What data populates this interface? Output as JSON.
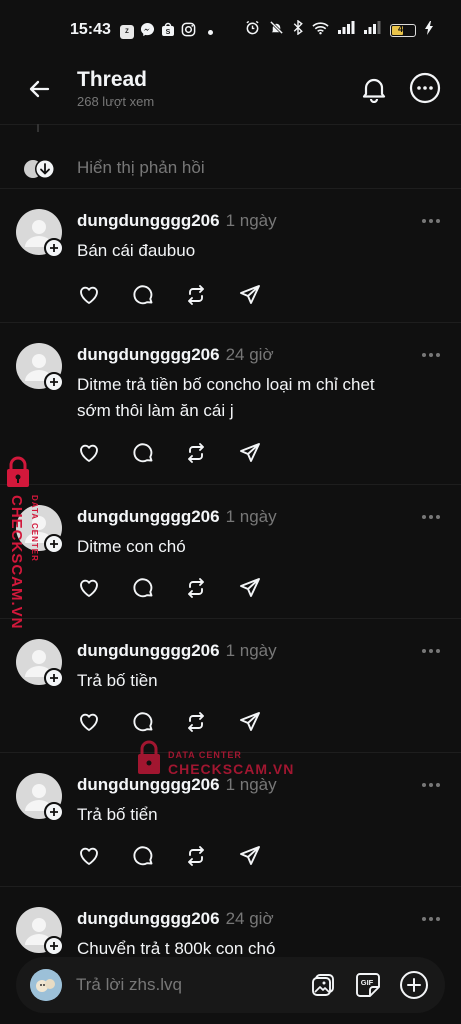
{
  "status_bar": {
    "time": "15:43",
    "battery": "47",
    "left_icons": [
      "zalo-icon",
      "messenger-icon",
      "shopee-icon",
      "instagram-icon"
    ],
    "right_icons": [
      "alarm-icon",
      "mute-icon",
      "bluetooth-icon",
      "wifi-icon",
      "signal-icon",
      "signal-icon",
      "battery-icon",
      "charging-icon"
    ]
  },
  "header": {
    "title": "Thread",
    "subtitle": "268 lượt xem"
  },
  "show_replies": {
    "label": "Hiển thị phản hồi"
  },
  "posts": [
    {
      "username": "dungdungggg206",
      "time": "1 ngày",
      "lines": [
        "Bán cái đaubuo"
      ]
    },
    {
      "username": "dungdungggg206",
      "time": "24 giờ",
      "lines": [
        "Ditme trả tiền bố concho loại m chỉ chet",
        "sớm thôi làm ăn cái j"
      ]
    },
    {
      "username": "dungdungggg206",
      "time": "1 ngày",
      "lines": [
        "Ditme con chó"
      ]
    },
    {
      "username": "dungdungggg206",
      "time": "1 ngày",
      "lines": [
        "Trả bố tiền"
      ]
    },
    {
      "username": "dungdungggg206",
      "time": "1 ngày",
      "lines": [
        "Trả bố tiển"
      ]
    },
    {
      "username": "dungdungggg206",
      "time": "24 giờ",
      "lines": [
        "Chuyển trả t 800k con chó"
      ]
    }
  ],
  "watermark": {
    "vertical_line1": "DATA CENTER",
    "vertical_line2": "CHECKSCAM.VN",
    "center_line1": "DATA CENTER",
    "center_line2": "CHECKSCAM.VN",
    "color": "#d2183b"
  },
  "reply_bar": {
    "placeholder": "Trả lời zhs.lvq",
    "gif_label": "GIF"
  },
  "colors": {
    "background": "#101010",
    "text_primary": "#f3f5f7",
    "text_secondary": "#777777"
  }
}
